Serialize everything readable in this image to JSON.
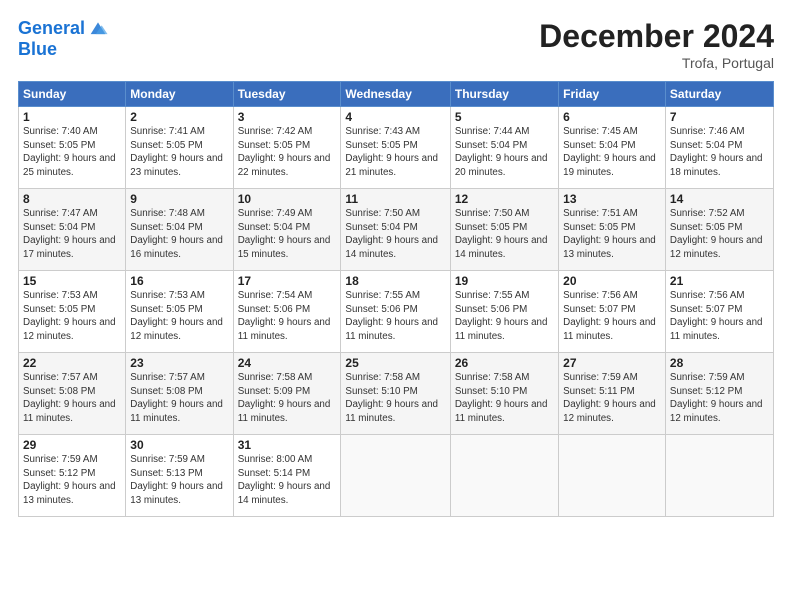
{
  "header": {
    "logo_line1": "General",
    "logo_line2": "Blue",
    "month_year": "December 2024",
    "location": "Trofa, Portugal"
  },
  "days_of_week": [
    "Sunday",
    "Monday",
    "Tuesday",
    "Wednesday",
    "Thursday",
    "Friday",
    "Saturday"
  ],
  "weeks": [
    [
      {
        "day": "1",
        "sunrise": "7:40 AM",
        "sunset": "5:05 PM",
        "daylight": "9 hours and 25 minutes."
      },
      {
        "day": "2",
        "sunrise": "7:41 AM",
        "sunset": "5:05 PM",
        "daylight": "9 hours and 23 minutes."
      },
      {
        "day": "3",
        "sunrise": "7:42 AM",
        "sunset": "5:05 PM",
        "daylight": "9 hours and 22 minutes."
      },
      {
        "day": "4",
        "sunrise": "7:43 AM",
        "sunset": "5:05 PM",
        "daylight": "9 hours and 21 minutes."
      },
      {
        "day": "5",
        "sunrise": "7:44 AM",
        "sunset": "5:04 PM",
        "daylight": "9 hours and 20 minutes."
      },
      {
        "day": "6",
        "sunrise": "7:45 AM",
        "sunset": "5:04 PM",
        "daylight": "9 hours and 19 minutes."
      },
      {
        "day": "7",
        "sunrise": "7:46 AM",
        "sunset": "5:04 PM",
        "daylight": "9 hours and 18 minutes."
      }
    ],
    [
      {
        "day": "8",
        "sunrise": "7:47 AM",
        "sunset": "5:04 PM",
        "daylight": "9 hours and 17 minutes."
      },
      {
        "day": "9",
        "sunrise": "7:48 AM",
        "sunset": "5:04 PM",
        "daylight": "9 hours and 16 minutes."
      },
      {
        "day": "10",
        "sunrise": "7:49 AM",
        "sunset": "5:04 PM",
        "daylight": "9 hours and 15 minutes."
      },
      {
        "day": "11",
        "sunrise": "7:50 AM",
        "sunset": "5:04 PM",
        "daylight": "9 hours and 14 minutes."
      },
      {
        "day": "12",
        "sunrise": "7:50 AM",
        "sunset": "5:05 PM",
        "daylight": "9 hours and 14 minutes."
      },
      {
        "day": "13",
        "sunrise": "7:51 AM",
        "sunset": "5:05 PM",
        "daylight": "9 hours and 13 minutes."
      },
      {
        "day": "14",
        "sunrise": "7:52 AM",
        "sunset": "5:05 PM",
        "daylight": "9 hours and 12 minutes."
      }
    ],
    [
      {
        "day": "15",
        "sunrise": "7:53 AM",
        "sunset": "5:05 PM",
        "daylight": "9 hours and 12 minutes."
      },
      {
        "day": "16",
        "sunrise": "7:53 AM",
        "sunset": "5:05 PM",
        "daylight": "9 hours and 12 minutes."
      },
      {
        "day": "17",
        "sunrise": "7:54 AM",
        "sunset": "5:06 PM",
        "daylight": "9 hours and 11 minutes."
      },
      {
        "day": "18",
        "sunrise": "7:55 AM",
        "sunset": "5:06 PM",
        "daylight": "9 hours and 11 minutes."
      },
      {
        "day": "19",
        "sunrise": "7:55 AM",
        "sunset": "5:06 PM",
        "daylight": "9 hours and 11 minutes."
      },
      {
        "day": "20",
        "sunrise": "7:56 AM",
        "sunset": "5:07 PM",
        "daylight": "9 hours and 11 minutes."
      },
      {
        "day": "21",
        "sunrise": "7:56 AM",
        "sunset": "5:07 PM",
        "daylight": "9 hours and 11 minutes."
      }
    ],
    [
      {
        "day": "22",
        "sunrise": "7:57 AM",
        "sunset": "5:08 PM",
        "daylight": "9 hours and 11 minutes."
      },
      {
        "day": "23",
        "sunrise": "7:57 AM",
        "sunset": "5:08 PM",
        "daylight": "9 hours and 11 minutes."
      },
      {
        "day": "24",
        "sunrise": "7:58 AM",
        "sunset": "5:09 PM",
        "daylight": "9 hours and 11 minutes."
      },
      {
        "day": "25",
        "sunrise": "7:58 AM",
        "sunset": "5:10 PM",
        "daylight": "9 hours and 11 minutes."
      },
      {
        "day": "26",
        "sunrise": "7:58 AM",
        "sunset": "5:10 PM",
        "daylight": "9 hours and 11 minutes."
      },
      {
        "day": "27",
        "sunrise": "7:59 AM",
        "sunset": "5:11 PM",
        "daylight": "9 hours and 12 minutes."
      },
      {
        "day": "28",
        "sunrise": "7:59 AM",
        "sunset": "5:12 PM",
        "daylight": "9 hours and 12 minutes."
      }
    ],
    [
      {
        "day": "29",
        "sunrise": "7:59 AM",
        "sunset": "5:12 PM",
        "daylight": "9 hours and 13 minutes."
      },
      {
        "day": "30",
        "sunrise": "7:59 AM",
        "sunset": "5:13 PM",
        "daylight": "9 hours and 13 minutes."
      },
      {
        "day": "31",
        "sunrise": "8:00 AM",
        "sunset": "5:14 PM",
        "daylight": "9 hours and 14 minutes."
      },
      null,
      null,
      null,
      null
    ]
  ]
}
